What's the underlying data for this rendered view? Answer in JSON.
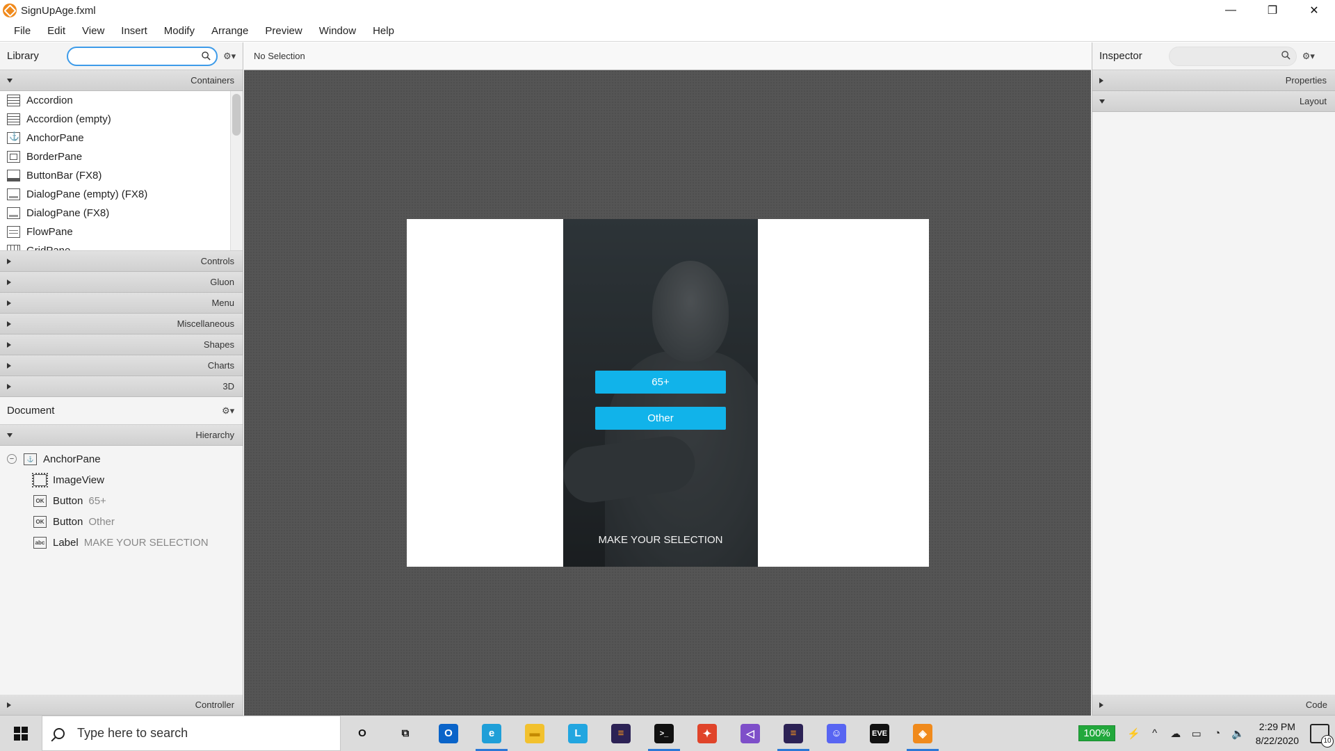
{
  "window": {
    "title": "SignUpAge.fxml",
    "controls": [
      "—",
      "❐",
      "✕"
    ]
  },
  "menubar": [
    "File",
    "Edit",
    "View",
    "Insert",
    "Modify",
    "Arrange",
    "Preview",
    "Window",
    "Help"
  ],
  "library": {
    "header": "Library",
    "search_value": "",
    "sections_top": {
      "label": "Containers"
    },
    "containers": [
      {
        "label": "Accordion",
        "icon": "accordion-icon",
        "cls": "accordion"
      },
      {
        "label": "Accordion  (empty)",
        "icon": "accordion-icon",
        "cls": "accordion"
      },
      {
        "label": "AnchorPane",
        "icon": "anchor-pane-icon",
        "cls": "anchor"
      },
      {
        "label": "BorderPane",
        "icon": "border-pane-icon",
        "cls": "border"
      },
      {
        "label": "ButtonBar  (FX8)",
        "icon": "button-bar-icon",
        "cls": "bar"
      },
      {
        "label": "DialogPane (empty)  (FX8)",
        "icon": "dialog-pane-icon",
        "cls": "dialog"
      },
      {
        "label": "DialogPane  (FX8)",
        "icon": "dialog-pane-icon",
        "cls": "dialog"
      },
      {
        "label": "FlowPane",
        "icon": "flow-pane-icon",
        "cls": "flow"
      },
      {
        "label": "GridPane",
        "icon": "grid-pane-icon",
        "cls": "grid"
      }
    ],
    "sections": [
      "Controls",
      "Gluon",
      "Menu",
      "Miscellaneous",
      "Shapes",
      "Charts",
      "3D"
    ]
  },
  "document": {
    "header": "Document",
    "hierarchy_label": "Hierarchy",
    "tree": [
      {
        "type": "AnchorPane",
        "sub": "",
        "icon": "anchor-pane-icon",
        "root": true
      },
      {
        "type": "ImageView",
        "sub": "",
        "icon": "image-view-icon",
        "root": false
      },
      {
        "type": "Button",
        "sub": "65+",
        "icon": "button-icon",
        "root": false
      },
      {
        "type": "Button",
        "sub": "Other",
        "icon": "button-icon",
        "root": false
      },
      {
        "type": "Label",
        "sub": "MAKE YOUR SELECTION",
        "icon": "label-icon",
        "root": false
      }
    ],
    "controller_label": "Controller"
  },
  "center": {
    "status": "No Selection",
    "preview": {
      "button_65": "65+",
      "button_other": "Other",
      "label": "MAKE YOUR SELECTION"
    }
  },
  "inspector": {
    "header": "Inspector",
    "sections": [
      {
        "label": "Properties",
        "expanded": false
      },
      {
        "label": "Layout",
        "expanded": true
      }
    ],
    "code_label": "Code"
  },
  "taskbar": {
    "search_placeholder": "Type here to search",
    "apps": [
      {
        "name": "cortana-icon",
        "glyph": "O",
        "color": "transparent",
        "text_color": "#111",
        "active": false
      },
      {
        "name": "task-view-icon",
        "glyph": "⧉",
        "color": "transparent",
        "text_color": "#111",
        "active": false
      },
      {
        "name": "outlook-icon",
        "glyph": "O",
        "color": "#0a64c9",
        "text_color": "#fff",
        "active": false
      },
      {
        "name": "edge-icon",
        "glyph": "e",
        "color": "#1f9fd8",
        "text_color": "#fff",
        "active": true
      },
      {
        "name": "file-explorer-icon",
        "glyph": "▬",
        "color": "#f2c12e",
        "text_color": "#c48a00",
        "active": false
      },
      {
        "name": "l-app-icon",
        "glyph": "L",
        "color": "#22a6e0",
        "text_color": "#fff",
        "active": false
      },
      {
        "name": "eclipse-icon",
        "glyph": "≡",
        "color": "#2c2255",
        "text_color": "#f7941e",
        "active": false
      },
      {
        "name": "terminal-icon",
        "glyph": ">_",
        "color": "#111",
        "text_color": "#fff",
        "active": true
      },
      {
        "name": "unity-hub-icon",
        "glyph": "✦",
        "color": "#e0442a",
        "text_color": "#fff",
        "active": false
      },
      {
        "name": "visual-studio-icon",
        "glyph": "◁",
        "color": "#7e4fc9",
        "text_color": "#fff",
        "active": false
      },
      {
        "name": "eclipse-2-icon",
        "glyph": "≡",
        "color": "#2c2255",
        "text_color": "#f7941e",
        "active": true
      },
      {
        "name": "discord-icon",
        "glyph": "☺",
        "color": "#5865f2",
        "text_color": "#fff",
        "active": false
      },
      {
        "name": "eve-icon",
        "glyph": "EVE",
        "color": "#111",
        "text_color": "#fff",
        "active": false
      },
      {
        "name": "scene-builder-icon",
        "glyph": "◈",
        "color": "#f08a1c",
        "text_color": "#fff",
        "active": true
      }
    ],
    "battery": "100%",
    "time": "2:29 PM",
    "date": "8/22/2020",
    "notifications": "10"
  }
}
